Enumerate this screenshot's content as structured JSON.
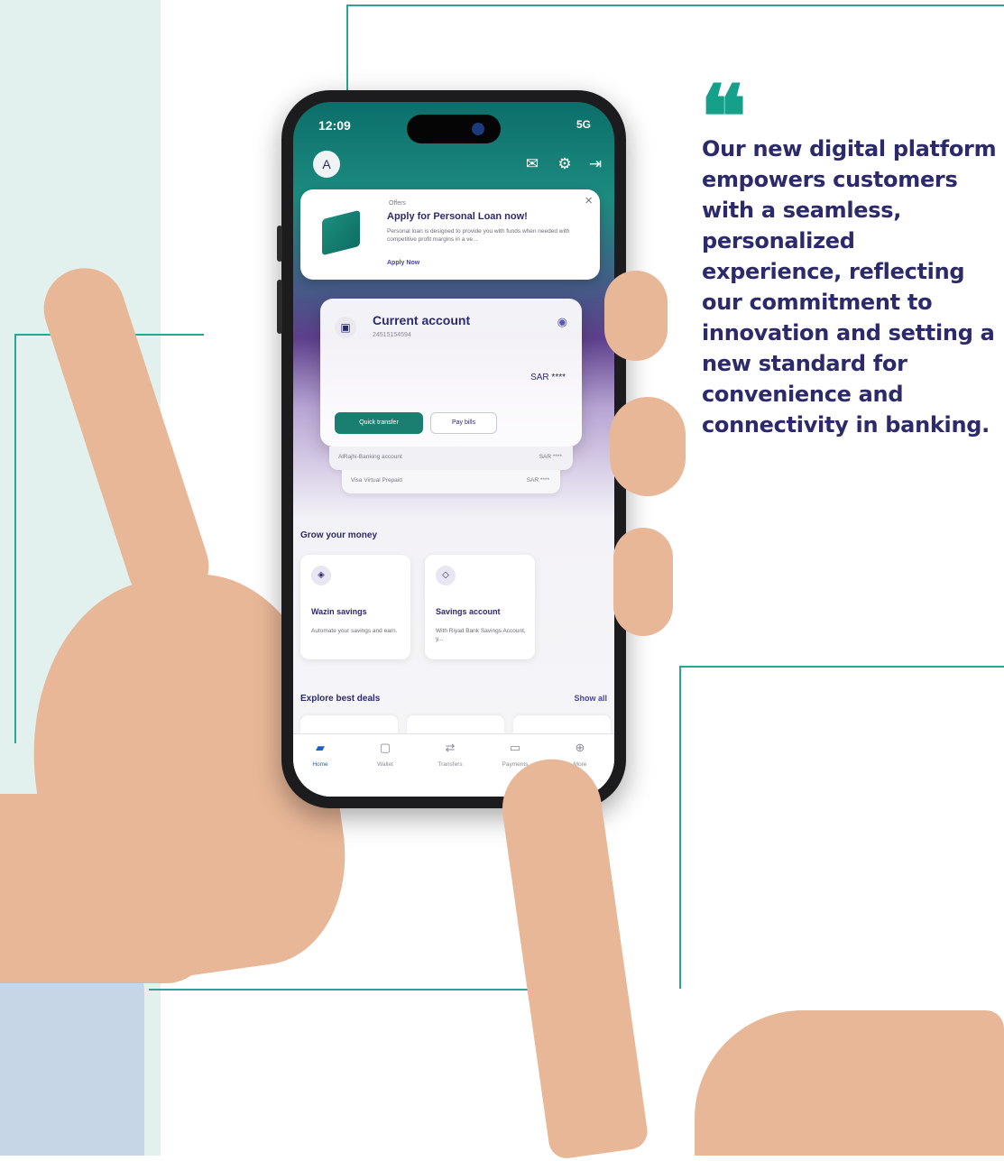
{
  "quote": {
    "mark": "❝",
    "text": "Our new digital platform empowers customers with a seamless, personalized experience, reflecting our commitment to innovation and setting a new standard for convenience and connectivity in banking."
  },
  "phone": {
    "status_time": "12:09",
    "status_right": "5G",
    "avatar_letter": "A",
    "offer": {
      "tag": "Offers",
      "title": "Apply for Personal Loan now!",
      "description": "Personal loan is designed to provide you with funds when needed with competitive profit margins in a ve...",
      "link": "Apply Now"
    },
    "account": {
      "name": "Current account",
      "number": "24515154594",
      "balance": "SAR ****",
      "quick_transfer": "Quick transfer",
      "pay_bills": "Pay bills"
    },
    "stacked": [
      {
        "label": "AlRajhi-Banking account",
        "value": "SAR ****"
      },
      {
        "label": "Visa Virtual Prepaid",
        "value": "SAR ****"
      }
    ],
    "grow": {
      "title": "Grow your money",
      "cards": [
        {
          "title": "Wazin savings",
          "description": "Automate your savings and earn."
        },
        {
          "title": "Savings account",
          "description": "With Riyad Bank Savings Account, y..."
        }
      ]
    },
    "deals": {
      "title": "Explore best deals",
      "show_all": "Show all"
    },
    "tabs": [
      {
        "label": "Home"
      },
      {
        "label": "Wallet"
      },
      {
        "label": "Transfers"
      },
      {
        "label": "Payments"
      },
      {
        "label": "More"
      }
    ]
  }
}
